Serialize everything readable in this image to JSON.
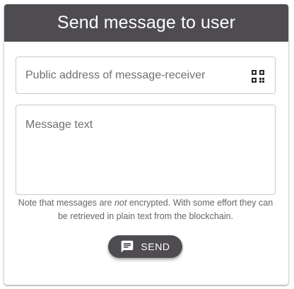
{
  "header": {
    "title": "Send message to user"
  },
  "address_field": {
    "placeholder": "Public address of message-receiver",
    "icon": "qr-code-icon"
  },
  "message_field": {
    "placeholder": "Message text"
  },
  "note": {
    "before": "Note that messages are ",
    "emphasis": "not",
    "after": " encrypted. With some effort they can be retrieved in plain text from the blockchain."
  },
  "send_button": {
    "label": "SEND",
    "icon": "chat-icon"
  },
  "colors": {
    "header_bg": "#4f4c51",
    "button_bg": "#4f4c51",
    "text_on_dark": "#ffffff"
  }
}
